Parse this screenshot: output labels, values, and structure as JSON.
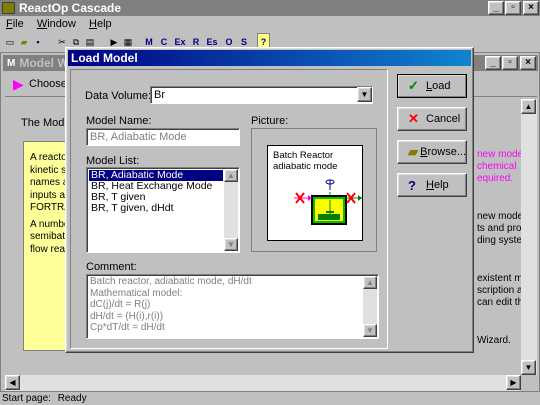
{
  "app": {
    "title": "ReactOp Cascade"
  },
  "menu": [
    {
      "key": "F",
      "rest": "ile"
    },
    {
      "key": "W",
      "rest": "indow"
    },
    {
      "key": "H",
      "rest": "elp"
    }
  ],
  "toolbar": {
    "letters": [
      "M",
      "C",
      "Ex",
      "R",
      "Es",
      "O",
      "S"
    ],
    "help": "?"
  },
  "background": {
    "window_title": "Model W",
    "choose_text": "Choose",
    "the_model_text": "The Mode",
    "yellow_lines": [
      "A reacto",
      "kinetic s",
      "names a",
      "inputs a",
      "FORTRA",
      "A numbe",
      "semibat",
      "flow rea"
    ],
    "right_lines": [
      {
        "text": "new model fro",
        "color": "magenta"
      },
      {
        "text": "chemical",
        "color": "magenta"
      },
      {
        "text": "equired.",
        "color": "magenta"
      },
      {
        "text": "new model. U",
        "color": "black"
      },
      {
        "text": "ts and progra",
        "color": "black"
      },
      {
        "text": "ding system o",
        "color": "black"
      },
      {
        "text": "existent model.",
        "color": "black"
      },
      {
        "text": "scription and",
        "color": "black"
      },
      {
        "text": "can edit them.",
        "color": "black"
      },
      {
        "text": "Wizard.",
        "color": "black"
      }
    ]
  },
  "status": {
    "label": "Start page:",
    "value": "Ready"
  },
  "dialog": {
    "title": "Load Model",
    "data_volume_label": "Data Volume:",
    "data_volume_value": "Br",
    "model_name_label": "Model Name:",
    "model_name_value": "BR, Adiabatic Mode",
    "model_list_label": "Model List:",
    "model_list": [
      "BR, Adiabatic Mode",
      "BR, Heat Exchange Mode",
      "BR, T given",
      "BR, T given, dHdt"
    ],
    "picture_label": "Picture:",
    "picture_caption_1": "Batch Reactor",
    "picture_caption_2": "adiabatic mode",
    "comment_label": "Comment:",
    "comment_lines": [
      "Batch reactor, adiabatic mode, dH/dt",
      "Mathematical model:",
      "dC(j)/dt = R(j)",
      "dH/dt = (H(i),r(i))",
      "Cp*dT/dt = dH/dt"
    ],
    "buttons": {
      "load": {
        "pre": "",
        "key": "L",
        "post": "oad"
      },
      "cancel": {
        "pre": "Cancel",
        "key": "",
        "post": ""
      },
      "browse": {
        "pre": "",
        "key": "B",
        "post": "rowse..."
      },
      "help": {
        "pre": "",
        "key": "H",
        "post": "elp"
      }
    }
  }
}
